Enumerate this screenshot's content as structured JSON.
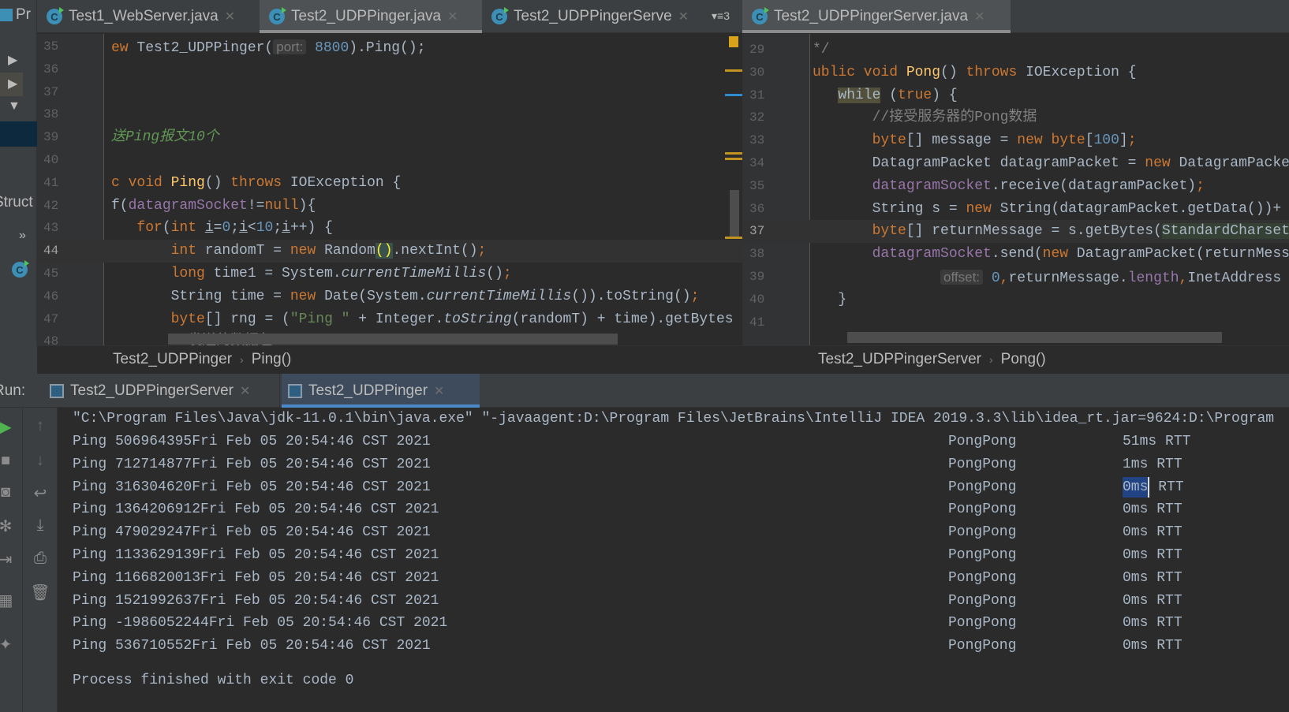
{
  "left_panel": {
    "project_label": "Pr",
    "structure_label": "Struct",
    "more": "»"
  },
  "left_tabs": [
    {
      "label": "Test1_WebServer.java",
      "active": false
    },
    {
      "label": "Test2_UDPPinger.java",
      "active": true
    },
    {
      "label": "Test2_UDPPingerServe",
      "active": false
    }
  ],
  "tab_overflow": "▾≡3",
  "right_tabs": [
    {
      "label": "Test2_UDPPingerServer.java",
      "active": true
    }
  ],
  "left_editor": {
    "current_line": 44,
    "lines": [
      {
        "n": 35,
        "t": [
          [
            "ew ",
            "k"
          ],
          [
            "Test2_UDPPinger(",
            ""
          ],
          [
            "port:",
            "h"
          ],
          [
            " 8800",
            "n"
          ],
          [
            ").Ping();",
            ""
          ]
        ]
      },
      {
        "n": 36,
        "t": []
      },
      {
        "n": 37,
        "t": []
      },
      {
        "n": 38,
        "t": []
      },
      {
        "n": 39,
        "t": [
          [
            "送Ping报文10个",
            "d"
          ]
        ]
      },
      {
        "n": 40,
        "t": []
      },
      {
        "n": 41,
        "t": [
          [
            "c void ",
            "k"
          ],
          [
            "Ping",
            "m"
          ],
          [
            "() ",
            ""
          ],
          [
            "throws ",
            "k"
          ],
          [
            "IOException {",
            ""
          ]
        ]
      },
      {
        "n": 42,
        "t": [
          [
            "f(",
            ""
          ],
          [
            "datagramSocket",
            "f"
          ],
          [
            "!=",
            ""
          ],
          [
            "null",
            "k"
          ],
          [
            "){",
            ""
          ]
        ]
      },
      {
        "n": 43,
        "t": [
          [
            "   for",
            "k"
          ],
          [
            "(",
            ""
          ],
          [
            "int ",
            "k"
          ],
          [
            "i",
            "u"
          ],
          [
            "=",
            ""
          ],
          [
            "0",
            "n"
          ],
          [
            ";",
            ""
          ],
          [
            "i",
            "u"
          ],
          [
            "<",
            ""
          ],
          [
            "10",
            "n"
          ],
          [
            ";",
            ""
          ],
          [
            "i",
            "u"
          ],
          [
            "++) {",
            ""
          ]
        ]
      },
      {
        "n": 44,
        "t": [
          [
            "       int ",
            "k"
          ],
          [
            "randomT = ",
            ""
          ],
          [
            "new ",
            "k"
          ],
          [
            "Random",
            ""
          ],
          [
            "()",
            "b"
          ],
          [
            ".nextInt()",
            ""
          ],
          [
            ";",
            "k"
          ]
        ]
      },
      {
        "n": 45,
        "t": [
          [
            "       long ",
            "k"
          ],
          [
            "time1 = System.",
            ""
          ],
          [
            "currentTimeMillis",
            "i"
          ],
          [
            "()",
            ""
          ],
          [
            ";",
            "k"
          ]
        ]
      },
      {
        "n": 46,
        "t": [
          [
            "       String time = ",
            ""
          ],
          [
            "new ",
            "k"
          ],
          [
            "Date(System.",
            ""
          ],
          [
            "currentTimeMillis",
            "i"
          ],
          [
            "()).toString()",
            ""
          ],
          [
            ";",
            "k"
          ]
        ]
      },
      {
        "n": 47,
        "t": [
          [
            "       byte",
            "k"
          ],
          [
            "[] rng = (",
            ""
          ],
          [
            "\"Ping \"",
            "s"
          ],
          [
            " + Integer.",
            ""
          ],
          [
            "toString",
            "i"
          ],
          [
            "(randomT) + time).getBytes",
            ""
          ]
        ]
      },
      {
        "n": 48,
        "t": [
          [
            "       //发送的数据包",
            "c"
          ]
        ]
      }
    ]
  },
  "right_editor": {
    "current_line": 37,
    "lines": [
      {
        "n": 29,
        "t": [
          [
            "*/",
            "c"
          ]
        ]
      },
      {
        "n": 30,
        "t": [
          [
            "ublic void ",
            "k"
          ],
          [
            "Pong",
            "m"
          ],
          [
            "() ",
            ""
          ],
          [
            "throws ",
            "k"
          ],
          [
            "IOException {",
            ""
          ]
        ]
      },
      {
        "n": 31,
        "t": [
          [
            "   ",
            ""
          ],
          [
            "while",
            "w"
          ],
          [
            " (",
            ""
          ],
          [
            "true",
            "k"
          ],
          [
            ") {",
            ""
          ]
        ]
      },
      {
        "n": 32,
        "t": [
          [
            "       //接受服务器的Pong数据",
            "c"
          ]
        ]
      },
      {
        "n": 33,
        "t": [
          [
            "       byte",
            "k"
          ],
          [
            "[] message = ",
            ""
          ],
          [
            "new byte",
            "k"
          ],
          [
            "[",
            ""
          ],
          [
            "100",
            "n"
          ],
          [
            "]",
            ""
          ],
          [
            ";",
            "k"
          ]
        ]
      },
      {
        "n": 34,
        "t": [
          [
            "       DatagramPacket datagramPacket = ",
            ""
          ],
          [
            "new ",
            "k"
          ],
          [
            "DatagramPacket",
            ""
          ]
        ]
      },
      {
        "n": 35,
        "t": [
          [
            "       datagramSocket",
            "f"
          ],
          [
            ".receive(datagramPacket)",
            ""
          ],
          [
            ";",
            "k"
          ]
        ]
      },
      {
        "n": 36,
        "t": [
          [
            "       String s = ",
            ""
          ],
          [
            "new ",
            "k"
          ],
          [
            "String(datagramPacket.getData())+",
            ""
          ]
        ]
      },
      {
        "n": 37,
        "t": [
          [
            "       byte",
            "k"
          ],
          [
            "[] returnMessage = s.getBytes(",
            ""
          ],
          [
            "StandardCharsets",
            "g"
          ]
        ]
      },
      {
        "n": 38,
        "t": [
          [
            "       datagramSocket",
            "f"
          ],
          [
            ".send(",
            ""
          ],
          [
            "new ",
            "k"
          ],
          [
            "DatagramPacket(returnMessage",
            ""
          ]
        ]
      },
      {
        "n": 39,
        "t": [
          [
            "               ",
            ""
          ],
          [
            "offset:",
            "h"
          ],
          [
            " 0",
            "n"
          ],
          [
            ",",
            "k"
          ],
          [
            "returnMessage.",
            ""
          ],
          [
            "length",
            "f"
          ],
          [
            ",",
            "k"
          ],
          [
            "InetAddress",
            ""
          ]
        ]
      },
      {
        "n": 40,
        "t": [
          [
            "   }",
            ""
          ]
        ]
      },
      {
        "n": 41,
        "t": []
      }
    ]
  },
  "left_breadcrumb": {
    "class": "Test2_UDPPinger",
    "method": "Ping()"
  },
  "right_breadcrumb": {
    "class": "Test2_UDPPingerServer",
    "method": "Pong()"
  },
  "run": {
    "label": "Run:",
    "tabs": [
      {
        "label": "Test2_UDPPingerServer",
        "active": false
      },
      {
        "label": "Test2_UDPPinger",
        "active": true
      }
    ]
  },
  "console": {
    "command": "\"C:\\Program Files\\Java\\jdk-11.0.1\\bin\\java.exe\" \"-javaagent:D:\\Program Files\\JetBrains\\IntelliJ IDEA 2019.3.3\\lib\\idea_rt.jar=9624:D:\\Program",
    "rows": [
      {
        "ping": "Ping 506964395Fri Feb 05 20:54:46 CST 2021",
        "pong": "PongPong",
        "ms": "51ms",
        "rtt": "RTT"
      },
      {
        "ping": "Ping 712714877Fri Feb 05 20:54:46 CST 2021",
        "pong": "PongPong",
        "ms": "1ms",
        "rtt": "RTT"
      },
      {
        "ping": "Ping 316304620Fri Feb 05 20:54:46 CST 2021",
        "pong": "PongPong",
        "ms": "0ms",
        "rtt": "RTT",
        "selected": true
      },
      {
        "ping": "Ping 1364206912Fri Feb 05 20:54:46 CST 2021",
        "pong": "PongPong",
        "ms": "0ms",
        "rtt": "RTT"
      },
      {
        "ping": "Ping 479029247Fri Feb 05 20:54:46 CST 2021",
        "pong": "PongPong",
        "ms": "0ms",
        "rtt": "RTT"
      },
      {
        "ping": "Ping 1133629139Fri Feb 05 20:54:46 CST 2021",
        "pong": "PongPong",
        "ms": "0ms",
        "rtt": "RTT"
      },
      {
        "ping": "Ping 1166820013Fri Feb 05 20:54:46 CST 2021",
        "pong": "PongPong",
        "ms": "0ms",
        "rtt": "RTT"
      },
      {
        "ping": "Ping 1521992637Fri Feb 05 20:54:46 CST 2021",
        "pong": "PongPong",
        "ms": "0ms",
        "rtt": "RTT"
      },
      {
        "ping": "Ping -1986052244Fri Feb 05 20:54:46 CST 2021",
        "pong": "PongPong",
        "ms": "0ms",
        "rtt": "RTT"
      },
      {
        "ping": "Ping 536710552Fri Feb 05 20:54:46 CST 2021",
        "pong": "PongPong",
        "ms": "0ms",
        "rtt": "RTT"
      }
    ],
    "exit": "Process finished with exit code 0"
  },
  "icons": {
    "console_left": [
      "run-icon",
      "stop-icon",
      "camera-icon",
      "settings-icon",
      "login-icon",
      "layout-icon",
      "pin-icon"
    ],
    "console_right": [
      "arrow-up-icon",
      "arrow-down-icon",
      "soft-wrap-icon",
      "scroll-to-end-icon",
      "print-icon",
      "trash-icon"
    ]
  },
  "colors": {
    "keyword": "#cc7832",
    "field": "#9876aa",
    "number": "#6897bb",
    "string": "#6a8759",
    "comment": "#808080",
    "method": "#ffc66d",
    "selection": "#214283",
    "run_accent": "#4a88c7"
  }
}
